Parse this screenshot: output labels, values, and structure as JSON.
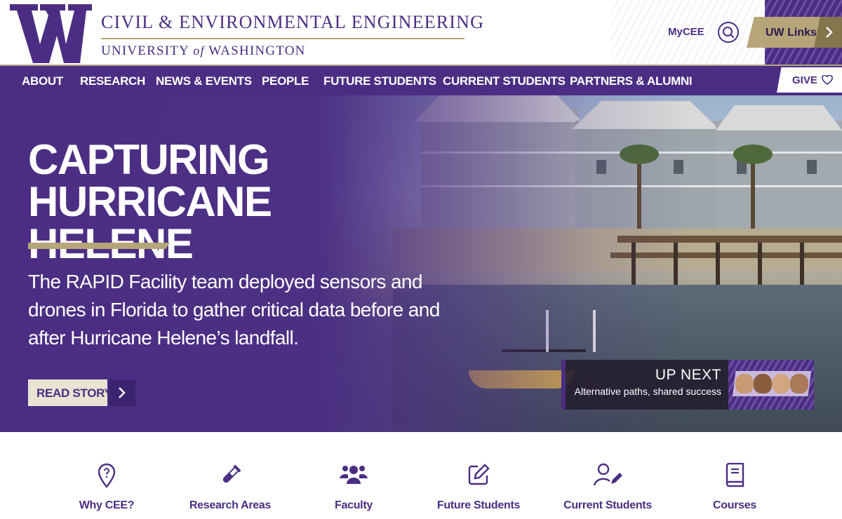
{
  "header": {
    "department": "CIVIL & ENVIRONMENTAL ENGINEERING",
    "university_pre": "UNIVERSITY",
    "university_of": "of",
    "university_post": "WASHINGTON",
    "mycee": "MyCEE",
    "uw_links": "UW Links"
  },
  "nav": {
    "items": [
      "ABOUT",
      "RESEARCH",
      "NEWS & EVENTS",
      "PEOPLE",
      "FUTURE STUDENTS",
      "CURRENT STUDENTS",
      "PARTNERS & ALUMNI"
    ],
    "give": "GIVE"
  },
  "hero": {
    "title_line1": "CAPTURING HURRICANE",
    "title_line2": "HELENE",
    "description": "The RAPID Facility team deployed sensors and drones in Florida to gather critical data before and after Hurricane Helene’s landfall.",
    "cta": "READ STORY",
    "up_next_heading": "UP NEXT",
    "up_next_title": "Alternative paths, shared success"
  },
  "quick_links": [
    {
      "label": "Why CEE?",
      "icon": "location-question-icon"
    },
    {
      "label": "Research Areas",
      "icon": "test-tube-icon"
    },
    {
      "label": "Faculty",
      "icon": "people-group-icon"
    },
    {
      "label": "Future Students",
      "icon": "edit-square-icon"
    },
    {
      "label": "Current Students",
      "icon": "user-pen-icon"
    },
    {
      "label": "Courses",
      "icon": "book-icon"
    }
  ],
  "colors": {
    "purple": "#4b2e83",
    "gold": "#b7a57a",
    "dark_gold": "#85754d"
  }
}
